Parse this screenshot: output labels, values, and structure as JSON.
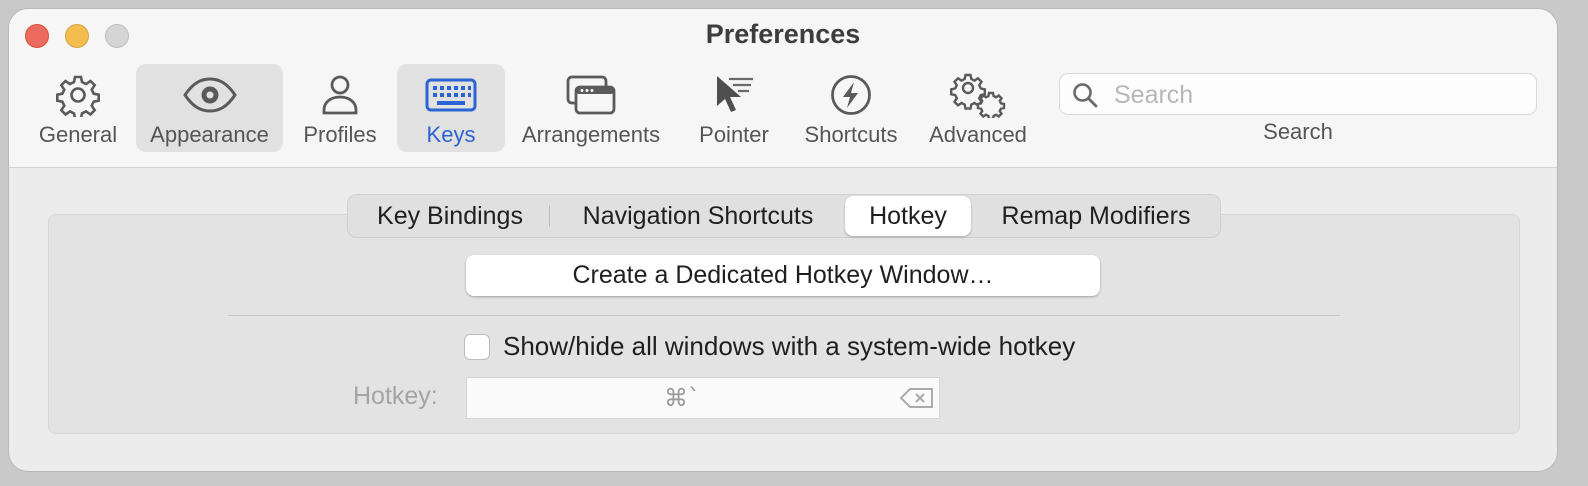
{
  "window": {
    "title": "Preferences"
  },
  "toolbar": {
    "items": [
      {
        "label": "General",
        "icon": "gear-icon"
      },
      {
        "label": "Appearance",
        "icon": "eye-icon"
      },
      {
        "label": "Profiles",
        "icon": "person-icon"
      },
      {
        "label": "Keys",
        "icon": "keyboard-icon"
      },
      {
        "label": "Arrangements",
        "icon": "windows-icon"
      },
      {
        "label": "Pointer",
        "icon": "cursor-icon"
      },
      {
        "label": "Shortcuts",
        "icon": "bolt-icon"
      },
      {
        "label": "Advanced",
        "icon": "gears-icon"
      }
    ],
    "search": {
      "placeholder": "Search",
      "value": "",
      "label": "Search"
    },
    "active_item": "Keys",
    "accent_color": "#2a63d3"
  },
  "tabs": {
    "items": [
      "Key Bindings",
      "Navigation Shortcuts",
      "Hotkey",
      "Remap Modifiers"
    ],
    "selected": "Hotkey"
  },
  "hotkey_panel": {
    "create_button_label": "Create a Dedicated Hotkey Window…",
    "checkbox_label": "Show/hide all windows with a system-wide hotkey",
    "checkbox_checked": false,
    "hotkey_label": "Hotkey:",
    "hotkey_value": "⌘`"
  }
}
